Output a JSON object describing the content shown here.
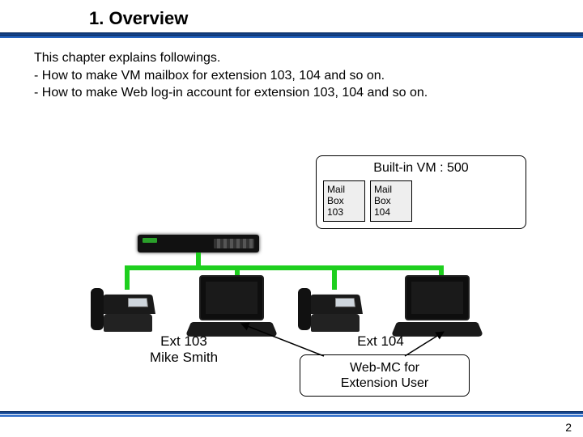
{
  "title": "1. Overview",
  "intro": {
    "line1": "This chapter explains followings.",
    "line2": "- How to make VM mailbox for extension 103, 104 and so on.",
    "line3": "- How to make Web log-in account for extension 103, 104 and so on."
  },
  "vm": {
    "label": "Built-in VM : 500",
    "mailboxes": [
      {
        "l1": "Mail",
        "l2": "Box",
        "l3": "103"
      },
      {
        "l1": "Mail",
        "l2": "Box",
        "l3": "104"
      }
    ]
  },
  "ext103": {
    "line1": "Ext 103",
    "line2": "Mike Smith"
  },
  "ext104": {
    "line1": "Ext 104"
  },
  "webmc": {
    "line1": "Web-MC for",
    "line2": "Extension User"
  },
  "page": "2"
}
